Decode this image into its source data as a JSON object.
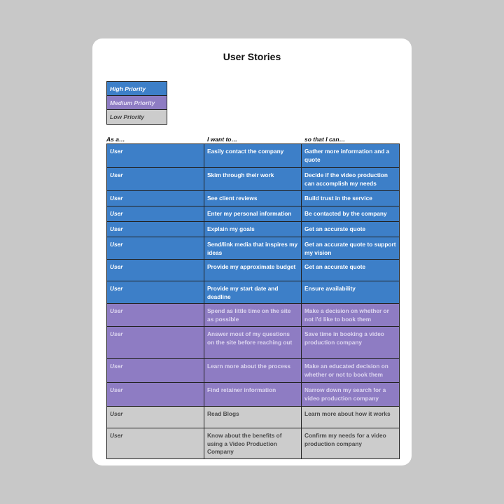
{
  "title": "User Stories",
  "legend": {
    "high": "High Priority",
    "medium": "Medium Priority",
    "low": "Low Priority"
  },
  "columns": {
    "role": "As a…",
    "want": "I want to…",
    "benefit": "so that I can…"
  },
  "colors": {
    "high": "#3d7fc8",
    "medium": "#8e7cc3",
    "low": "#cccccc"
  },
  "stories": [
    {
      "priority": "high",
      "role": "User",
      "want": "Easily contact the company",
      "benefit": "Gather more information and a quote"
    },
    {
      "priority": "high",
      "role": "User",
      "want": "Skim through their work",
      "benefit": "Decide if the video production can accomplish my needs"
    },
    {
      "priority": "high",
      "role": "User",
      "want": "See client reviews",
      "benefit": "Build trust in the service"
    },
    {
      "priority": "high",
      "role": "User",
      "want": "Enter my personal information",
      "benefit": "Be contacted by the company"
    },
    {
      "priority": "high",
      "role": "User",
      "want": "Explain my goals",
      "benefit": "Get an accurate quote"
    },
    {
      "priority": "high",
      "role": "User",
      "want": "Send/link media that inspires my ideas",
      "benefit": "Get an accurate quote to support my vision"
    },
    {
      "priority": "high",
      "role": "User",
      "want": "Provide my approximate budget",
      "benefit": "Get an accurate quote"
    },
    {
      "priority": "high",
      "role": "User",
      "want": "Provide my start date and deadline",
      "benefit": "Ensure availability"
    },
    {
      "priority": "medium",
      "role": "User",
      "want": "Spend as little time on the site as possible",
      "benefit": "Make a decision on whether or not I'd like to book them"
    },
    {
      "priority": "medium",
      "role": "User",
      "want": "Answer most of my questions on the site before reaching out",
      "benefit": "Save time in booking a video production company"
    },
    {
      "priority": "medium",
      "role": "User",
      "want": "Learn more about the process",
      "benefit": "Make an educated decision on whether or not to book them"
    },
    {
      "priority": "medium",
      "role": "User",
      "want": "Find retainer information",
      "benefit": "Narrow down my search for a video production company"
    },
    {
      "priority": "low",
      "role": "User",
      "want": "Read Blogs",
      "benefit": "Learn more about how it works"
    },
    {
      "priority": "low",
      "role": "User",
      "want": "Know about the benefits of using a Video Production Company",
      "benefit": "Confirm my needs for a video production company"
    }
  ]
}
